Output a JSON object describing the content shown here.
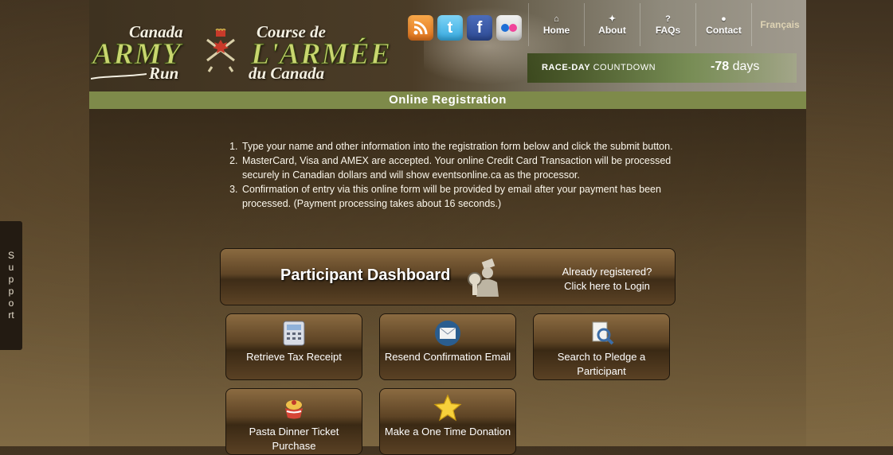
{
  "support": {
    "label": "Support"
  },
  "logo": {
    "en_line1": "Canada",
    "en_line2": "ARMY",
    "en_line3": "Run",
    "fr_line1": "Course de",
    "fr_line2": "L'ARMÉE",
    "fr_line3": "du Canada"
  },
  "social": [
    {
      "name": "rss-icon",
      "glyph": "◉"
    },
    {
      "name": "twitter-icon",
      "glyph": "t"
    },
    {
      "name": "facebook-icon",
      "glyph": "f"
    },
    {
      "name": "flickr-icon",
      "glyph": "●●"
    }
  ],
  "nav": {
    "items": [
      {
        "label": "Home",
        "icon": "home-icon"
      },
      {
        "label": "About",
        "icon": "maple-leaf-icon"
      },
      {
        "label": "FAQs",
        "icon": "question-icon"
      },
      {
        "label": "Contact",
        "icon": "person-icon"
      }
    ],
    "language": "Français"
  },
  "countdown": {
    "label_bold": "RACE-DAY",
    "label_rest": " COUNTDOWN",
    "value": "-78",
    "unit": " days"
  },
  "page": {
    "title": "Online  Registration"
  },
  "instructions": [
    "Type your name and other information into the registration form below and click the submit button.",
    "MasterCard, Visa and AMEX are accepted. Your online Credit Card Transaction will be processed securely in Canadian dollars and will show eventsonline.ca as the processor.",
    "Confirmation of entry via this online form will be provided by email after your payment has been processed. (Payment processing takes about 16 seconds.)"
  ],
  "dashboard": {
    "title": "Participant Dashboard",
    "line1": "Already registered?",
    "line2": "Click here to Login",
    "icon": "dashboard-person-icon"
  },
  "tiles": [
    {
      "label": "Retrieve Tax Receipt",
      "icon": "calculator-icon"
    },
    {
      "label": "Resend Confirmation Email",
      "icon": "email-icon"
    },
    {
      "label": "Search to Pledge a Participant",
      "icon": "magnifier-document-icon"
    },
    {
      "label": "Pasta Dinner Ticket Purchase",
      "icon": "pasta-bowl-icon"
    },
    {
      "label": "Make a One Time Donation",
      "icon": "star-icon"
    }
  ],
  "colors": {
    "accent_bar": "#7e8a4a",
    "logo_green": "#c9d66f",
    "nav_language": "#ded3b4"
  }
}
